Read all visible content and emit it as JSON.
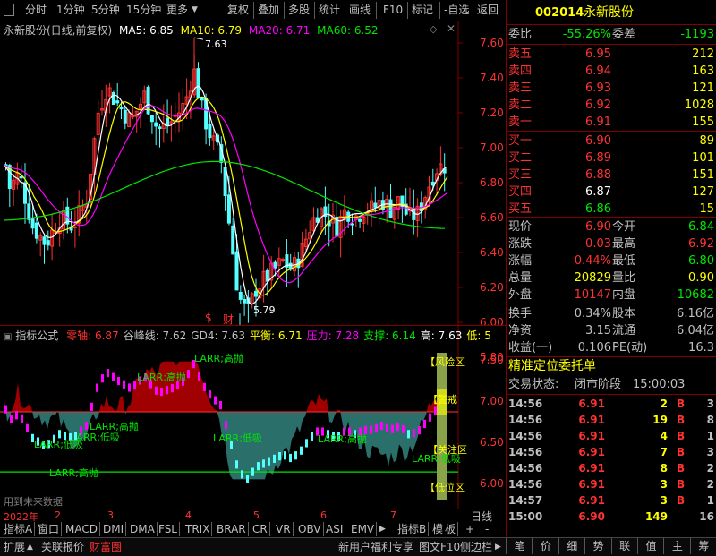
{
  "toolbar": {
    "left": [
      "分时",
      "1分钟",
      "5分钟",
      "15分钟",
      "更多"
    ],
    "right": [
      "复权",
      "叠加",
      "多股",
      "统计",
      "画线",
      "F10",
      "标记",
      "-自选",
      "返回"
    ]
  },
  "main_chart": {
    "title": "永新股份(日线,前复权)",
    "ma5_label": "MA5: 6.85",
    "ma10_label": "MA10: 6.79",
    "ma20_label": "MA20: 6.71",
    "ma60_label": "MA60: 6.52",
    "high_marker": "7.63",
    "low_marker": "5.79",
    "events": [
      "$",
      "财"
    ],
    "y_ticks": [
      "7.60",
      "7.40",
      "7.20",
      "7.00",
      "6.80",
      "6.60",
      "6.40",
      "6.20",
      "6.00",
      "5.80"
    ],
    "colors": {
      "ma5": "#ffffff",
      "ma10": "#ffff00",
      "ma20": "#ff00ff",
      "ma60": "#00e600",
      "up": "#ff3232",
      "down": "#54ffff"
    }
  },
  "indicator": {
    "name": "指标公式",
    "items": [
      {
        "text": "零轴: 6.87",
        "color": "#ff3232"
      },
      {
        "text": "谷峰线: 7.62",
        "color": "#c0c0c0"
      },
      {
        "text": "GD4: 7.63",
        "color": "#c0c0c0"
      },
      {
        "text": "平衡: 6.71",
        "color": "#ffff00"
      },
      {
        "text": "压力: 7.28",
        "color": "#ff00ff"
      },
      {
        "text": "支撑: 6.14",
        "color": "#00e600"
      },
      {
        "text": "高: 7.63",
        "color": "#ffffff"
      },
      {
        "text": "低: 5",
        "color": "#ffff00"
      }
    ],
    "y_ticks": [
      "7.50",
      "7.00",
      "6.50",
      "6.00"
    ],
    "annotations": [
      "LARR;高抛",
      "LARR;高抛",
      "LARR;高抛",
      "LARR;低吸",
      "LARR;低吸",
      "LARR;低吸",
      "LARR;高抛",
      "LARR;高抛",
      "LARR;低吸"
    ],
    "right_labels": [
      "【风险区",
      "【警戒",
      "【关注区",
      "【低位区"
    ],
    "footer_note": "用到未来数据"
  },
  "dates": [
    "2022年",
    "2",
    "3",
    "4",
    "5",
    "6",
    "7"
  ],
  "date_right": "日线",
  "tabs": [
    "指标A",
    "窗口",
    "MACD",
    "DMI",
    "DMA",
    "FSL",
    "TRIX",
    "BRAR",
    "CR",
    "VR",
    "OBV",
    "ASI",
    "EMV"
  ],
  "tabs_right": [
    "指标B",
    "模",
    "板",
    "+",
    "-"
  ],
  "bottombar": {
    "left": [
      "扩展",
      "关联报价",
      "财富圈"
    ],
    "right": [
      "新用户福利专享",
      "图文F10",
      "侧边栏"
    ],
    "nav_tabs": [
      "笔",
      "价",
      "细",
      "势",
      "联",
      "值",
      "主",
      "筹"
    ]
  },
  "stock": {
    "code": "002014",
    "name": "永新股份"
  },
  "weibi": {
    "label": "委比",
    "value": "-55.26%",
    "label2": "委差",
    "value2": "-1193"
  },
  "sells": [
    {
      "label": "卖五",
      "price": "6.95",
      "vol": "212"
    },
    {
      "label": "卖四",
      "price": "6.94",
      "vol": "163"
    },
    {
      "label": "卖三",
      "price": "6.93",
      "vol": "121"
    },
    {
      "label": "卖二",
      "price": "6.92",
      "vol": "1028"
    },
    {
      "label": "卖一",
      "price": "6.91",
      "vol": "155"
    }
  ],
  "buys": [
    {
      "label": "买一",
      "price": "6.90",
      "vol": "89",
      "color": "#ff3232"
    },
    {
      "label": "买二",
      "price": "6.89",
      "vol": "101",
      "color": "#ff3232"
    },
    {
      "label": "买三",
      "price": "6.88",
      "vol": "151",
      "color": "#ff3232"
    },
    {
      "label": "买四",
      "price": "6.87",
      "vol": "127",
      "color": "#ffffff"
    },
    {
      "label": "买五",
      "price": "6.86",
      "vol": "15",
      "color": "#00e600"
    }
  ],
  "quote": [
    {
      "l1": "现价",
      "v1": "6.90",
      "c1": "#ff3232",
      "l2": "今开",
      "v2": "6.84",
      "c2": "#00e600"
    },
    {
      "l1": "涨跌",
      "v1": "0.03",
      "c1": "#ff3232",
      "l2": "最高",
      "v2": "6.92",
      "c2": "#ff3232"
    },
    {
      "l1": "涨幅",
      "v1": "0.44%",
      "c1": "#ff3232",
      "l2": "最低",
      "v2": "6.80",
      "c2": "#00e600"
    },
    {
      "l1": "总量",
      "v1": "20829",
      "c1": "#ffff00",
      "l2": "量比",
      "v2": "0.90",
      "c2": "#ffff00"
    },
    {
      "l1": "外盘",
      "v1": "10147",
      "c1": "#ff3232",
      "l2": "内盘",
      "v2": "10682",
      "c2": "#00e600"
    }
  ],
  "quote2": [
    {
      "l1": "换手",
      "v1": "0.34%",
      "l2": "股本",
      "v2": "6.16亿"
    },
    {
      "l1": "净资",
      "v1": "3.15",
      "l2": "流通",
      "v2": "6.04亿"
    },
    {
      "l1": "收益(一)",
      "v1": "0.106",
      "l2": "PE(动)",
      "v2": "16.3"
    }
  ],
  "precise_title": "精准定位委托单",
  "trade_state": {
    "label": "交易状态:",
    "state": "闭市阶段",
    "time": "15:00:03"
  },
  "trades": [
    {
      "time": "14:56",
      "price": "6.91",
      "vol": "2",
      "bs": "B",
      "n": "3"
    },
    {
      "time": "14:56",
      "price": "6.91",
      "vol": "19",
      "bs": "B",
      "n": "8"
    },
    {
      "time": "14:56",
      "price": "6.91",
      "vol": "4",
      "bs": "B",
      "n": "1"
    },
    {
      "time": "14:56",
      "price": "6.91",
      "vol": "7",
      "bs": "B",
      "n": "3"
    },
    {
      "time": "14:56",
      "price": "6.91",
      "vol": "8",
      "bs": "B",
      "n": "2"
    },
    {
      "time": "14:56",
      "price": "6.91",
      "vol": "3",
      "bs": "B",
      "n": "2"
    },
    {
      "time": "14:57",
      "price": "6.91",
      "vol": "3",
      "bs": "B",
      "n": "1"
    },
    {
      "time": "15:00",
      "price": "6.90",
      "vol": "149",
      "bs": "",
      "n": "16"
    }
  ]
}
